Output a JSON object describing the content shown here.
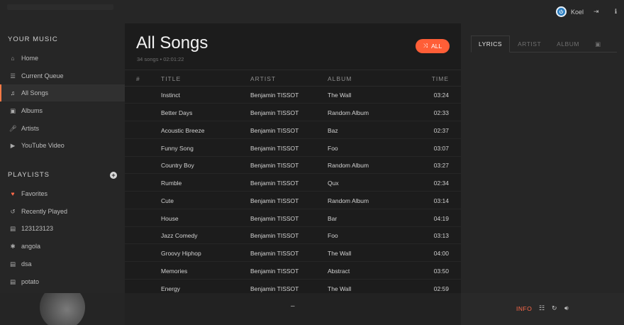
{
  "topbar": {
    "user_name": "Koel"
  },
  "sidebar": {
    "your_music_title": "YOUR MUSIC",
    "items": [
      {
        "label": "Home",
        "icon": "home-icon"
      },
      {
        "label": "Current Queue",
        "icon": "queue-list-icon"
      },
      {
        "label": "All Songs",
        "icon": "music-note-icon",
        "active": true
      },
      {
        "label": "Albums",
        "icon": "album-icon"
      },
      {
        "label": "Artists",
        "icon": "microphone-icon"
      },
      {
        "label": "YouTube Video",
        "icon": "youtube-icon"
      }
    ],
    "playlists_title": "PLAYLISTS",
    "playlists": [
      {
        "label": "Favorites",
        "icon": "heart-icon"
      },
      {
        "label": "Recently Played",
        "icon": "history-icon"
      },
      {
        "label": "123123123",
        "icon": "file-icon"
      },
      {
        "label": "angola",
        "icon": "asterisk-icon"
      },
      {
        "label": "dsa",
        "icon": "file-icon"
      },
      {
        "label": "potato",
        "icon": "file-icon"
      }
    ]
  },
  "main": {
    "title": "All Songs",
    "meta": "34 songs • 02:01:22",
    "shuffle_label": "ALL",
    "columns": {
      "num": "#",
      "title": "TITLE",
      "artist": "ARTIST",
      "album": "ALBUM",
      "time": "TIME"
    },
    "songs": [
      {
        "title": "Instinct",
        "artist": "Benjamin TISSOT",
        "album": "The Wall",
        "time": "03:24"
      },
      {
        "title": "Better Days",
        "artist": "Benjamin TISSOT",
        "album": "Random Album",
        "time": "02:33"
      },
      {
        "title": "Acoustic Breeze",
        "artist": "Benjamin TISSOT",
        "album": "Baz",
        "time": "02:37"
      },
      {
        "title": "Funny Song",
        "artist": "Benjamin TISSOT",
        "album": "Foo",
        "time": "03:07"
      },
      {
        "title": "Country Boy",
        "artist": "Benjamin TISSOT",
        "album": "Random Album",
        "time": "03:27"
      },
      {
        "title": "Rumble",
        "artist": "Benjamin TISSOT",
        "album": "Qux",
        "time": "02:34"
      },
      {
        "title": "Cute",
        "artist": "Benjamin TISSOT",
        "album": "Random Album",
        "time": "03:14"
      },
      {
        "title": "House",
        "artist": "Benjamin TISSOT",
        "album": "Bar",
        "time": "04:19"
      },
      {
        "title": "Jazz Comedy",
        "artist": "Benjamin TISSOT",
        "album": "Foo",
        "time": "03:13"
      },
      {
        "title": "Groovy Hiphop",
        "artist": "Benjamin TISSOT",
        "album": "The Wall",
        "time": "04:00"
      },
      {
        "title": "Memories",
        "artist": "Benjamin TISSOT",
        "album": "Abstract",
        "time": "03:50"
      },
      {
        "title": "Energy",
        "artist": "Benjamin TISSOT",
        "album": "The Wall",
        "time": "02:59"
      }
    ]
  },
  "extra": {
    "tabs": [
      "LYRICS",
      "ARTIST",
      "ALBUM"
    ],
    "active_tab": "LYRICS"
  },
  "footer": {
    "track_placeholder": "–",
    "info_label": "INFO"
  },
  "colors": {
    "accent": "#ff5e37",
    "user_avatar": "#2d7fc1"
  }
}
